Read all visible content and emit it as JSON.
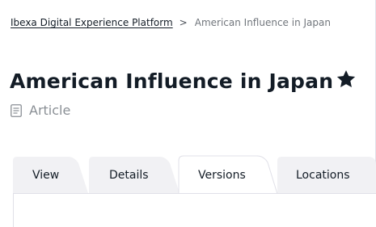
{
  "breadcrumb": {
    "root": "Ibexa Digital Experience Platform",
    "separator": ">",
    "current": "American Influence in Japan"
  },
  "header": {
    "title": "American Influence in Japan",
    "bookmark_icon": "star-icon",
    "content_type_icon": "article-icon",
    "content_type": "Article"
  },
  "tabs": [
    {
      "label": "View",
      "active": false
    },
    {
      "label": "Details",
      "active": false
    },
    {
      "label": "Versions",
      "active": true
    },
    {
      "label": "Locations",
      "active": false
    }
  ],
  "colors": {
    "text": "#131c26",
    "muted": "#71767c",
    "tab_inactive": "#f1f1f4",
    "border": "#e0e0e8"
  }
}
